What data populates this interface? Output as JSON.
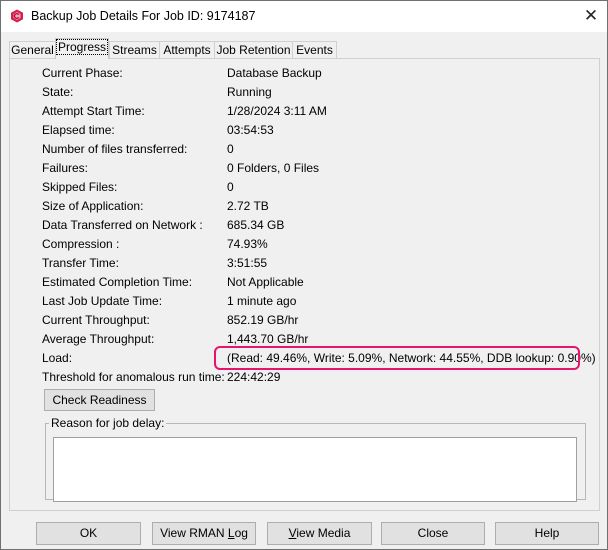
{
  "window": {
    "title": "Backup Job Details For Job ID: 9174187",
    "icon": "commvault-app-icon",
    "close_icon": "close-icon"
  },
  "tabs": [
    {
      "label": "General",
      "active": false
    },
    {
      "label": "Progress",
      "active": true
    },
    {
      "label": "Streams",
      "active": false
    },
    {
      "label": "Attempts",
      "active": false
    },
    {
      "label": "Job Retention",
      "active": false
    },
    {
      "label": "Events",
      "active": false
    }
  ],
  "progress": {
    "fields": [
      {
        "label": "Current Phase:",
        "value": "Database Backup"
      },
      {
        "label": "State:",
        "value": "Running"
      },
      {
        "label": "Attempt Start Time:",
        "value": "1/28/2024 3:11 AM"
      },
      {
        "label": "Elapsed time:",
        "value": "03:54:53"
      },
      {
        "label": "Number of files transferred:",
        "value": "0"
      },
      {
        "label": "Failures:",
        "value": "0 Folders, 0 Files"
      },
      {
        "label": "Skipped Files:",
        "value": "0"
      },
      {
        "label": "Size of Application:",
        "value": "2.72 TB"
      },
      {
        "label": "Data Transferred on Network :",
        "value": "685.34 GB"
      },
      {
        "label": "Compression :",
        "value": "74.93%"
      },
      {
        "label": "Transfer Time:",
        "value": "3:51:55"
      },
      {
        "label": "Estimated Completion Time:",
        "value": "Not Applicable"
      },
      {
        "label": "Last Job Update Time:",
        "value": "1 minute ago"
      },
      {
        "label": "Current Throughput:",
        "value": "852.19 GB/hr"
      },
      {
        "label": "Average Throughput:",
        "value": "1,443.70 GB/hr"
      },
      {
        "label": "Load:",
        "value": "(Read: 49.46%, Write: 5.09%, Network: 44.55%, DDB lookup: 0.90%)"
      },
      {
        "label": "Threshold for anomalous run time:",
        "value": "224:42:29"
      }
    ],
    "highlight_color": "#e8136b",
    "check_readiness_label": "Check Readiness",
    "reason_group_label": "Reason for job delay:",
    "reason_text": ""
  },
  "footer": {
    "ok": "OK",
    "view_rman_log_pre": "View RMAN ",
    "view_rman_log_u": "L",
    "view_rman_log_post": "og",
    "view_media_u": "V",
    "view_media_post": "iew Media",
    "close": "Close",
    "help": "Help"
  }
}
